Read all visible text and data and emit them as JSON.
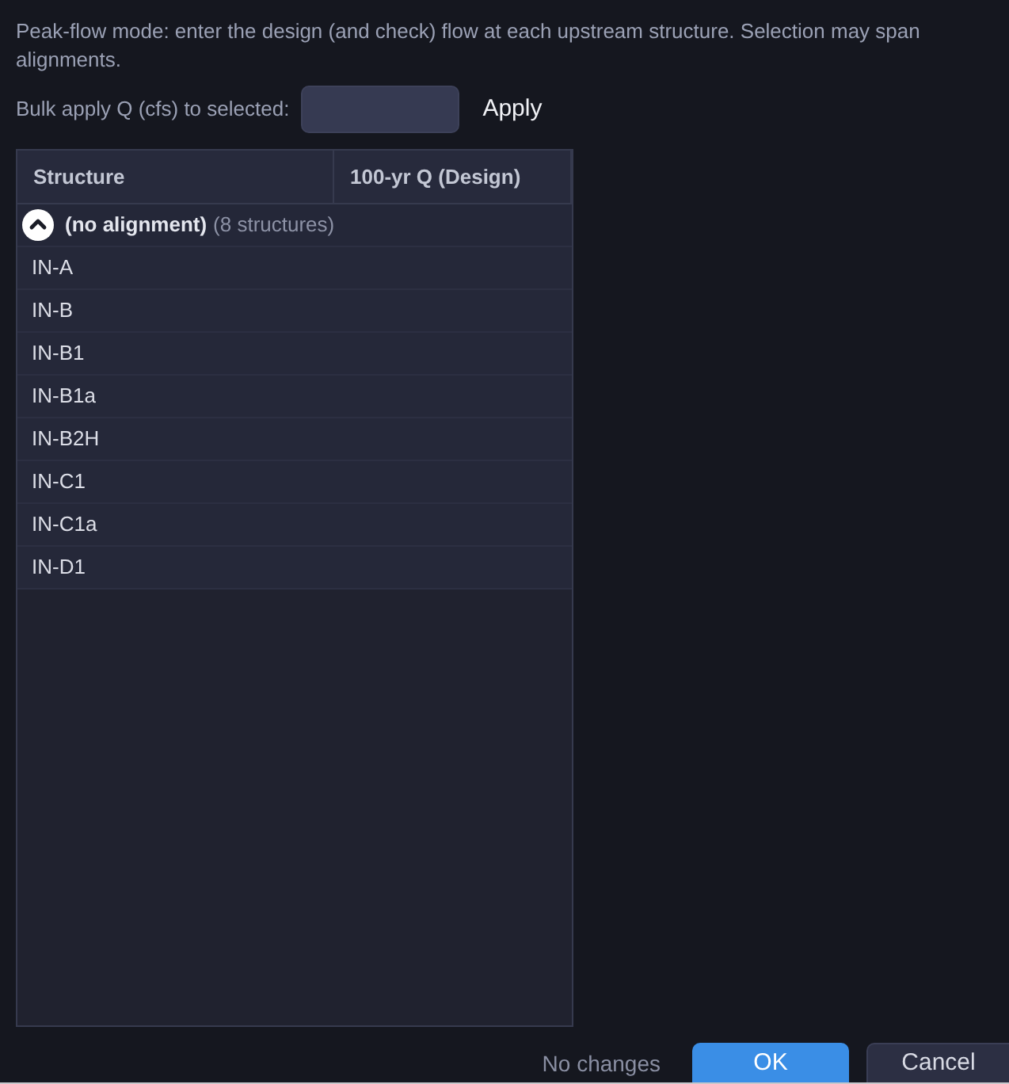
{
  "description": "Peak-flow mode: enter the design (and check) flow at each upstream structure. Selection may span alignments.",
  "bulk_apply": {
    "label": "Bulk apply Q (cfs) to selected:",
    "button": "Apply"
  },
  "table": {
    "columns": [
      "Structure",
      "100-yr Q (Design)"
    ],
    "groups": [
      {
        "name": "(no alignment)",
        "count": "(8 structures)",
        "expanded": true,
        "rows": [
          {
            "structure": "IN-A",
            "selected": false
          },
          {
            "structure": "IN-B",
            "selected": false
          },
          {
            "structure": "IN-B1",
            "selected": false
          },
          {
            "structure": "IN-B1a",
            "selected": false
          },
          {
            "structure": "IN-B2H",
            "selected": false
          },
          {
            "structure": "IN-C1",
            "selected": false
          },
          {
            "structure": "IN-C1a",
            "selected": false
          },
          {
            "structure": "IN-D1",
            "selected": false
          }
        ]
      }
    ]
  },
  "footer": {
    "status": "No changes",
    "buttons": [
      {
        "label": "OK",
        "kind": "primary"
      },
      {
        "label": "Cancel",
        "kind": "secondary"
      }
    ]
  }
}
